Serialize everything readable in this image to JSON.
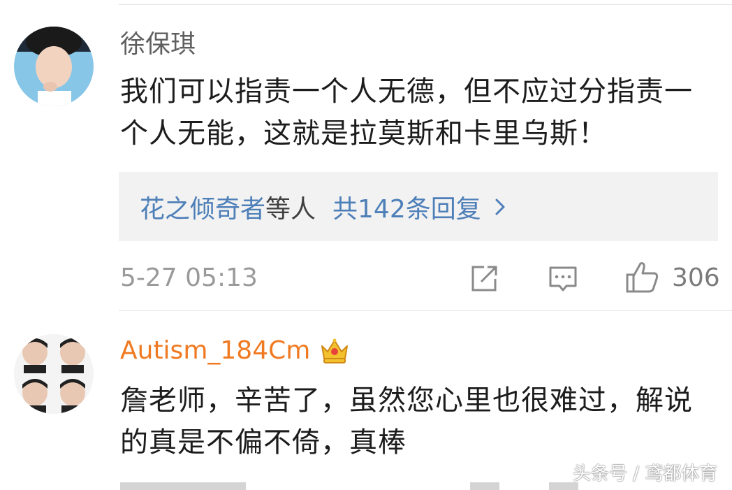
{
  "comments": [
    {
      "username": "徐保琪",
      "text": "我们可以指责一个人无德，但不应过分指责一个人无能，这就是拉莫斯和卡里乌斯！",
      "replies": {
        "names": "花之倾奇者",
        "suffix": "等人",
        "count_text": "共142条回复"
      },
      "time": "5-27 05:13",
      "likes": "306"
    },
    {
      "username": "Autism_184Cm",
      "text": "詹老师，辛苦了，虽然您心里也很难过，解说的真是不偏不倚，真棒"
    }
  ],
  "watermark": "头条号 / 鸢都体育",
  "colors": {
    "link_blue": "#4d7fb8",
    "vip_orange": "#f07a21",
    "meta_gray": "#9a9a9a"
  },
  "icons": [
    "share-icon",
    "reply-icon",
    "like-icon",
    "chevron-right-icon",
    "crown-icon"
  ]
}
